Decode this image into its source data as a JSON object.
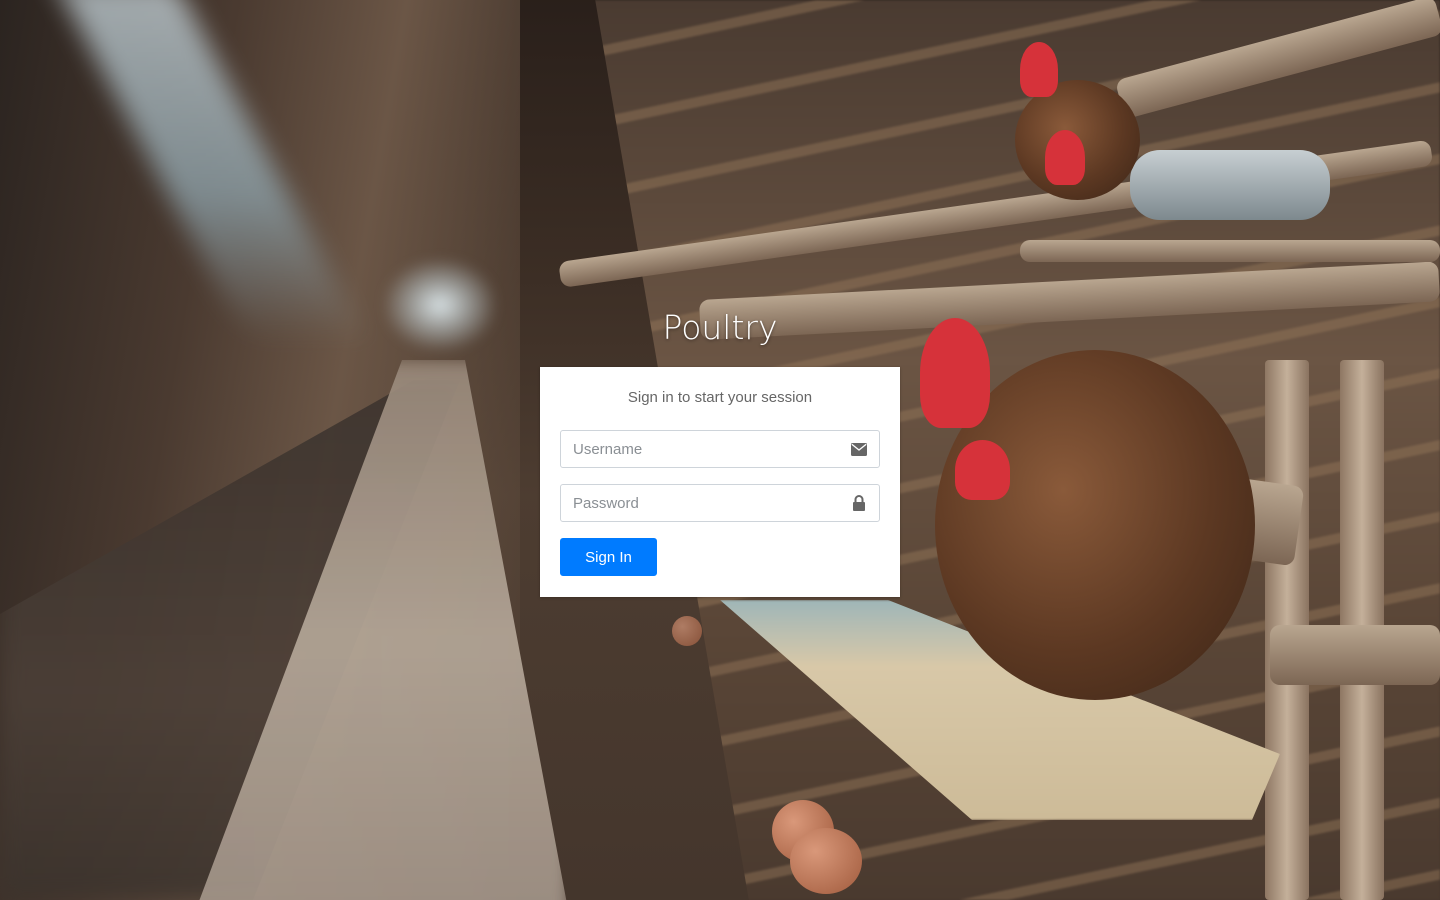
{
  "app": {
    "title": "Poultry"
  },
  "login": {
    "message": "Sign in to start your session",
    "username": {
      "placeholder": "Username",
      "value": "",
      "icon": "envelope-icon"
    },
    "password": {
      "placeholder": "Password",
      "value": "",
      "icon": "lock-icon"
    },
    "submit_label": "Sign In"
  },
  "colors": {
    "primary": "#007bff",
    "card_bg": "#ffffff",
    "title_text": "#ffffff"
  }
}
